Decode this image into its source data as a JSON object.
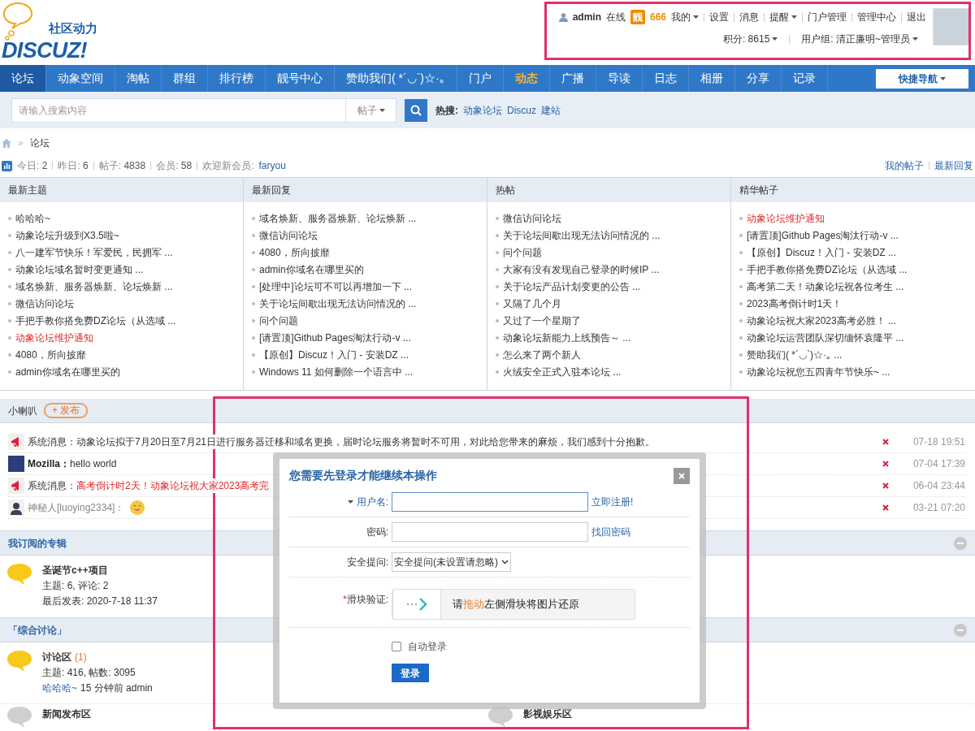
{
  "logo": {
    "tagline": "社区动力",
    "wordmark": "DISCUZ!"
  },
  "user_bar": {
    "username": "admin",
    "status": "在线",
    "badge": "靓",
    "badge_number": "666",
    "links": [
      {
        "label": "我的",
        "dropdown": true
      },
      {
        "label": "设置",
        "dropdown": false
      },
      {
        "label": "消息",
        "dropdown": false
      },
      {
        "label": "提醒",
        "dropdown": true
      },
      {
        "label": "门户管理",
        "dropdown": false
      },
      {
        "label": "管理中心",
        "dropdown": false
      },
      {
        "label": "退出",
        "dropdown": false
      }
    ],
    "points": "积分: 8615",
    "group": "用户组: 清正廉明~管理员"
  },
  "nav": {
    "items": [
      {
        "label": "论坛",
        "selected": true,
        "emphasized": false
      },
      {
        "label": "动象空间",
        "selected": false,
        "emphasized": false
      },
      {
        "label": "淘帖",
        "selected": false,
        "emphasized": false
      },
      {
        "label": "群组",
        "selected": false,
        "emphasized": false
      },
      {
        "label": "排行榜",
        "selected": false,
        "emphasized": false
      },
      {
        "label": "靓号中心",
        "selected": false,
        "emphasized": false
      },
      {
        "label": "赞助我们( *´◡`)☆·｡",
        "selected": false,
        "emphasized": false
      },
      {
        "label": "门户",
        "selected": false,
        "emphasized": false
      },
      {
        "label": "动态",
        "selected": false,
        "emphasized": true
      },
      {
        "label": "广播",
        "selected": false,
        "emphasized": false
      },
      {
        "label": "导读",
        "selected": false,
        "emphasized": false
      },
      {
        "label": "日志",
        "selected": false,
        "emphasized": false
      },
      {
        "label": "相册",
        "selected": false,
        "emphasized": false
      },
      {
        "label": "分享",
        "selected": false,
        "emphasized": false
      },
      {
        "label": "记录",
        "selected": false,
        "emphasized": false
      }
    ],
    "quick_nav": "快捷导航"
  },
  "search": {
    "placeholder": "请输入搜索内容",
    "scope": "帖子",
    "hot_label": "热搜:",
    "hot_terms": [
      "动象论坛",
      "Discuz",
      "建站"
    ]
  },
  "breadcrumb_separator": "»",
  "breadcrumb": [
    "论坛"
  ],
  "stats": [
    {
      "label": "今日:",
      "value": "2"
    },
    {
      "label": "昨日:",
      "value": "6"
    },
    {
      "label": "帖子:",
      "value": "4838"
    },
    {
      "label": "会员:",
      "value": "58"
    }
  ],
  "welcome": {
    "label": "欢迎新会员:",
    "member": "faryou"
  },
  "quick_links": [
    "我的帖子",
    "最新回复"
  ],
  "columns": [
    {
      "title": "最新主题",
      "items": [
        {
          "text": "哈哈哈~",
          "highlighted": false
        },
        {
          "text": "动象论坛升级到X3.5啦~",
          "highlighted": false
        },
        {
          "text": "八一建军节快乐！军爱民，民拥军 ...",
          "highlighted": false
        },
        {
          "text": "动象论坛域名暂时变更通知 ...",
          "highlighted": false
        },
        {
          "text": "域名焕新、服务器焕新、论坛焕新 ...",
          "highlighted": false
        },
        {
          "text": "微信访问论坛",
          "highlighted": false
        },
        {
          "text": "手把手教你搭免费DZ论坛（从选域 ...",
          "highlighted": false
        },
        {
          "text": "动象论坛维护通知",
          "highlighted": true
        },
        {
          "text": "4080，所向披靡",
          "highlighted": false
        },
        {
          "text": "admin你域名在哪里买的",
          "highlighted": false
        }
      ]
    },
    {
      "title": "最新回复",
      "items": [
        {
          "text": "域名焕新、服务器焕新、论坛焕新 ...",
          "highlighted": false
        },
        {
          "text": "微信访问论坛",
          "highlighted": false
        },
        {
          "text": "4080，所向披靡",
          "highlighted": false
        },
        {
          "text": "admin你域名在哪里买的",
          "highlighted": false
        },
        {
          "text": "[处理中]论坛可不可以再增加一下 ...",
          "highlighted": false
        },
        {
          "text": "关于论坛间歇出现无法访问情况的 ...",
          "highlighted": false
        },
        {
          "text": "问个问题",
          "highlighted": false
        },
        {
          "text": "[请置顶]Github Pages淘汰行动-v ...",
          "highlighted": false
        },
        {
          "text": "【原创】Discuz！入门 - 安装DZ ...",
          "highlighted": false
        },
        {
          "text": "Windows 11 如何删除一个语言中 ...",
          "highlighted": false
        }
      ]
    },
    {
      "title": "热帖",
      "items": [
        {
          "text": "微信访问论坛",
          "highlighted": false
        },
        {
          "text": "关于论坛间歇出现无法访问情况的 ...",
          "highlighted": false
        },
        {
          "text": "问个问题",
          "highlighted": false
        },
        {
          "text": "大家有没有发现自己登录的时候IP ...",
          "highlighted": false
        },
        {
          "text": "关于论坛产品计划变更的公告 ...",
          "highlighted": false
        },
        {
          "text": "又隔了几个月",
          "highlighted": false
        },
        {
          "text": "又过了一个星期了",
          "highlighted": false
        },
        {
          "text": "动象论坛新能力上线预告～ ...",
          "highlighted": false
        },
        {
          "text": "怎么来了两个新人",
          "highlighted": false
        },
        {
          "text": "火绒安全正式入驻本论坛 ...",
          "highlighted": false
        }
      ]
    },
    {
      "title": "精华帖子",
      "items": [
        {
          "text": "动象论坛维护通知",
          "highlighted": true
        },
        {
          "text": "[请置顶]Github Pages淘汰行动-v ...",
          "highlighted": false
        },
        {
          "text": "【原创】Discuz！入门 - 安装DZ ...",
          "highlighted": false
        },
        {
          "text": "手把手教你搭免费DZ论坛（从选域 ...",
          "highlighted": false
        },
        {
          "text": "高考第二天！动象论坛祝各位考生 ...",
          "highlighted": false
        },
        {
          "text": "2023高考倒计时1天！",
          "highlighted": false
        },
        {
          "text": "动象论坛祝大家2023高考必胜！ ...",
          "highlighted": false
        },
        {
          "text": "动象论坛运营团队深切缅怀袁隆平 ...",
          "highlighted": false
        },
        {
          "text": "赞助我们( *´◡`)☆·｡ ...",
          "highlighted": false
        },
        {
          "text": "动象论坛祝您五四青年节快乐~ ...",
          "highlighted": false
        }
      ]
    }
  ],
  "broadcast": {
    "title": "小喇叭",
    "post_button": "+ 发布",
    "messages": [
      {
        "kind": "system",
        "sender": "系统消息：",
        "text": "动象论坛拟于7月20日至7月21日进行服务器迁移和域名更换，届时论坛服务将暂时不可用，对此给您带来的麻烦，我们感到十分抱歉。",
        "alert": false,
        "time": "07-18 19:51"
      },
      {
        "kind": "user",
        "sender": "Mozilla：",
        "text": "hello world",
        "alert": false,
        "time": "07-04 17:39"
      },
      {
        "kind": "system",
        "sender": "系统消息：",
        "text": "高考倒计时2天！动象论坛祝大家2023高考完",
        "alert": true,
        "time": "06-04 23:44"
      },
      {
        "kind": "guest",
        "sender": "神秘人[luoying2334]：",
        "time": "03-21 07:20"
      }
    ]
  },
  "albums": {
    "title": "我订阅的专辑",
    "items": [
      {
        "name": "圣诞节c++项目",
        "meta": "主题: 6, 评论: 2",
        "last": "最后发表: 2020-7-18 11:37"
      }
    ]
  },
  "category": {
    "title": "「综合讨论」",
    "forums": [
      {
        "name": "讨论区",
        "new_count": "(1)",
        "meta": "主题: 416, 帖数: 3095",
        "last_thread": "哈哈哈~",
        "last_info": "15 分钟前 admin"
      }
    ],
    "more": [
      "新闻发布区",
      "影视娱乐区"
    ]
  },
  "login_dialog": {
    "title": "您需要先登录才能继续本操作",
    "username_label": "用户名:",
    "register_link": "立即注册!",
    "password_label": "密码:",
    "recover_link": "找回密码",
    "question_label": "安全提问:",
    "question_value": "安全提问(未设置请忽略)",
    "captcha_required_mark": "*",
    "captcha_label": "滑块验证:",
    "captcha_before": "请",
    "captcha_highlight": "拖动",
    "captcha_after": "左侧滑块将图片还原",
    "remember_label": "自动登录",
    "remember_checked": false,
    "submit": "登录"
  }
}
